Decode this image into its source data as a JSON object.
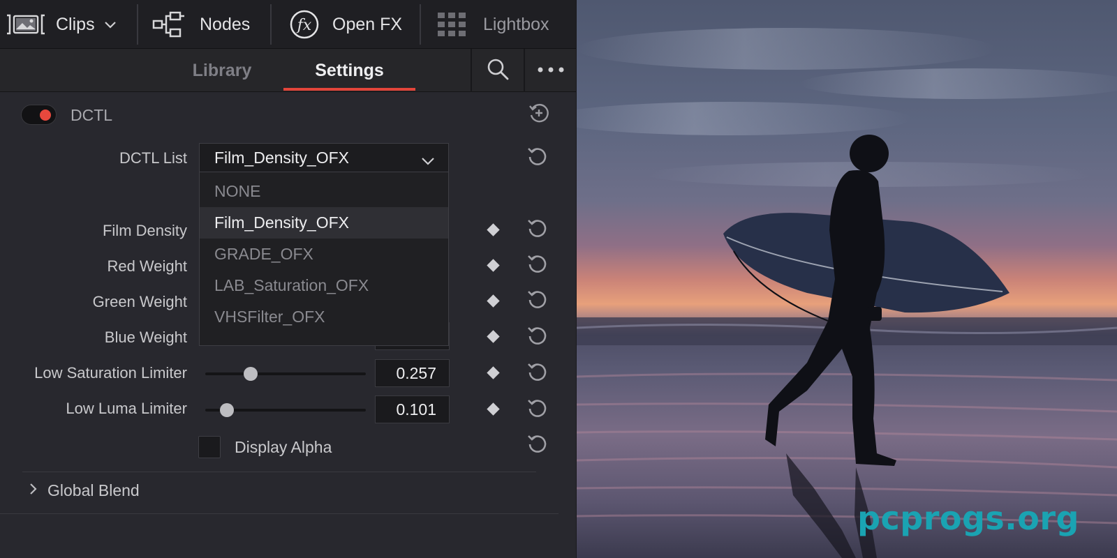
{
  "toolbar": {
    "clips_label": "Clips",
    "nodes_label": "Nodes",
    "openfx_label": "Open FX",
    "lightbox_label": "Lightbox"
  },
  "tabs": [
    {
      "label": "Library",
      "active": false
    },
    {
      "label": "Settings",
      "active": true
    }
  ],
  "dctl": {
    "title": "DCTL",
    "enabled": true,
    "list_label": "DCTL List",
    "selected": "Film_Density_OFX",
    "options": [
      "NONE",
      "Film_Density_OFX",
      "GRADE_OFX",
      "LAB_Saturation_OFX",
      "VHSFilter_OFX"
    ]
  },
  "params": [
    {
      "label": "Film Density"
    },
    {
      "label": "Red Weight"
    },
    {
      "label": "Green Weight"
    },
    {
      "label": "Blue Weight"
    },
    {
      "label": "Low Saturation Limiter",
      "value": "0.257",
      "slider": 0.26
    },
    {
      "label": "Low Luma Limiter",
      "value": "0.101",
      "slider": 0.1
    }
  ],
  "display_alpha": {
    "label": "Display Alpha",
    "checked": false
  },
  "global_blend": {
    "label": "Global Blend"
  },
  "watermark": "pcprogs.org",
  "colors": {
    "accent": "#e2453a",
    "toggle_on": "#e8483d",
    "watermark": "#1aa3b2"
  }
}
